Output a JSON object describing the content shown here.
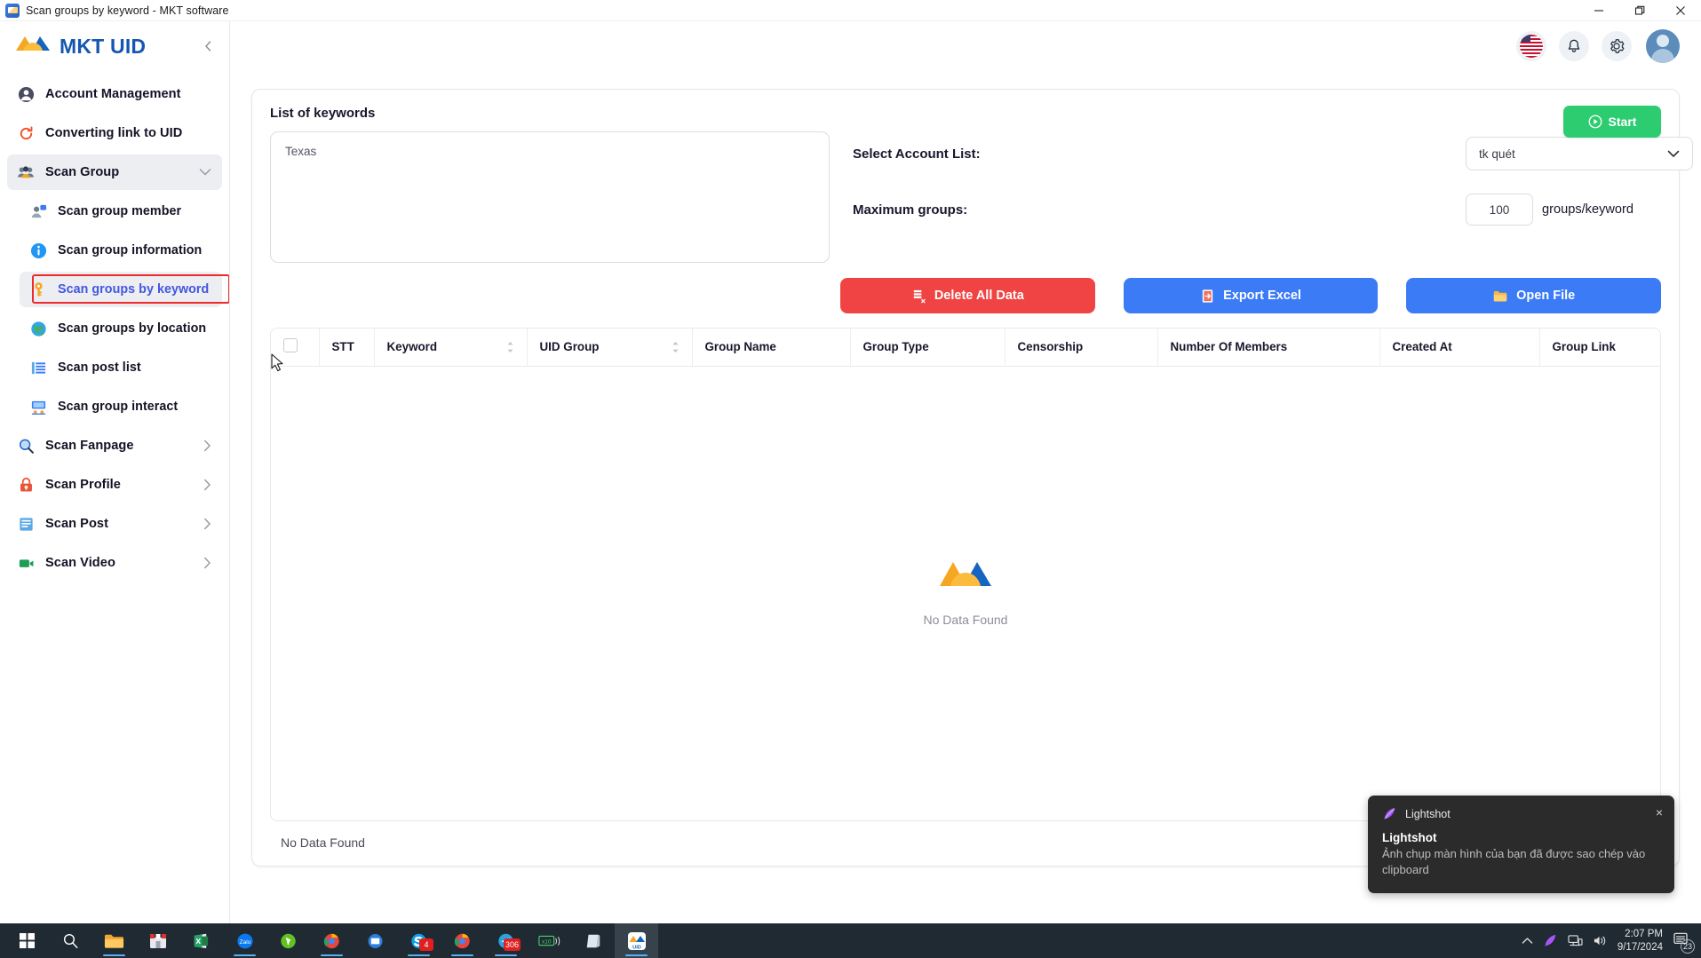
{
  "window": {
    "title": "Scan groups by keyword - MKT software",
    "minimize_label": "Minimize",
    "restore_label": "Restore",
    "close_label": "Close"
  },
  "sidebar": {
    "brand": "MKT UID",
    "collapse_label": "‹",
    "items": [
      {
        "label": "Account Management",
        "icon": "user-circle-icon",
        "level": 0,
        "state": "normal",
        "chevron": ""
      },
      {
        "label": "Converting link to UID",
        "icon": "refresh-icon",
        "level": 0,
        "state": "normal",
        "chevron": ""
      },
      {
        "label": "Scan Group",
        "icon": "group-icon",
        "level": 0,
        "state": "expanded",
        "chevron": "down"
      },
      {
        "label": "Scan group member",
        "icon": "member-icon",
        "level": 1,
        "state": "normal",
        "chevron": ""
      },
      {
        "label": "Scan group information",
        "icon": "info-icon",
        "level": 1,
        "state": "normal",
        "chevron": ""
      },
      {
        "label": "Scan groups by keyword",
        "icon": "key-icon",
        "level": 1,
        "state": "selected",
        "chevron": ""
      },
      {
        "label": "Scan groups by location",
        "icon": "globe-icon",
        "level": 1,
        "state": "normal",
        "chevron": ""
      },
      {
        "label": "Scan post list",
        "icon": "list-icon",
        "level": 1,
        "state": "normal",
        "chevron": ""
      },
      {
        "label": "Scan group interact",
        "icon": "interact-icon",
        "level": 1,
        "state": "normal",
        "chevron": ""
      },
      {
        "label": "Scan Fanpage",
        "icon": "magnifier-icon",
        "level": 0,
        "state": "normal",
        "chevron": "right"
      },
      {
        "label": "Scan Profile",
        "icon": "profile-lock-icon",
        "level": 0,
        "state": "normal",
        "chevron": "right"
      },
      {
        "label": "Scan Post",
        "icon": "post-icon",
        "level": 0,
        "state": "normal",
        "chevron": "right"
      },
      {
        "label": "Scan Video",
        "icon": "video-icon",
        "level": 0,
        "state": "normal",
        "chevron": "right"
      }
    ]
  },
  "header": {
    "language_icon": "us-flag-icon",
    "notifications_icon": "bell-icon",
    "settings_icon": "gear-icon",
    "avatar_icon": "user-avatar-icon"
  },
  "main": {
    "keywords_title": "List of keywords",
    "keywords_value": "Texas",
    "keywords_placeholder": "",
    "account_list_label": "Select Account List:",
    "account_list_value": "tk quét",
    "max_groups_label": "Maximum groups:",
    "max_groups_value": "100",
    "max_groups_unit": "groups/keyword",
    "start_button": "Start",
    "buttons": [
      {
        "label": "Delete All Data",
        "style": "danger",
        "icon": "delete-data-icon"
      },
      {
        "label": "Export Excel",
        "style": "primary",
        "icon": "excel-icon"
      },
      {
        "label": "Open File",
        "style": "primary",
        "icon": "folder-icon"
      }
    ]
  },
  "table": {
    "columns": [
      {
        "label": "",
        "sortable": false,
        "type": "checkbox"
      },
      {
        "label": "STT",
        "sortable": false
      },
      {
        "label": "Keyword",
        "sortable": true
      },
      {
        "label": "UID Group",
        "sortable": true
      },
      {
        "label": "Group Name",
        "sortable": false
      },
      {
        "label": "Group Type",
        "sortable": false
      },
      {
        "label": "Censorship",
        "sortable": false
      },
      {
        "label": "Number Of Members",
        "sortable": false
      },
      {
        "label": "Created At",
        "sortable": false
      },
      {
        "label": "Group Link",
        "sortable": false
      }
    ],
    "rows": [],
    "empty_message": "No Data Found",
    "footer_message": "No Data Found",
    "page_size": "10"
  },
  "toast": {
    "app_name": "Lightshot",
    "title": "Lightshot",
    "message": "Ảnh chụp màn hình của bạn đã được sao chép vào clipboard",
    "close_label": "×"
  },
  "taskbar": {
    "items": [
      {
        "name": "start-button",
        "icon": "windows-icon"
      },
      {
        "name": "search-button",
        "icon": "search-icon"
      },
      {
        "name": "file-explorer",
        "icon": "folder-icon"
      },
      {
        "name": "app-shop",
        "icon": "shop-icon"
      },
      {
        "name": "app-excel",
        "icon": "excel-icon"
      },
      {
        "name": "app-zalo",
        "icon": "zalo-icon",
        "label": "Zalo"
      },
      {
        "name": "app-media",
        "icon": "media-icon"
      },
      {
        "name": "app-chrome-profile",
        "icon": "chrome-icon"
      },
      {
        "name": "app-monitor",
        "icon": "monitor-icon"
      },
      {
        "name": "app-skype",
        "icon": "skype-icon",
        "badge": "4"
      },
      {
        "name": "app-chrome-2",
        "icon": "chrome-icon"
      },
      {
        "name": "app-telegram",
        "icon": "telegram-icon",
        "badge": "306"
      },
      {
        "name": "app-x10",
        "icon": "x10-icon",
        "label": "x10"
      },
      {
        "name": "app-notes",
        "icon": "notes-icon"
      },
      {
        "name": "app-mkt-uid",
        "icon": "mkt-uid-icon",
        "label": "UID"
      }
    ],
    "tray": {
      "overflow_icon": "chevron-up-icon",
      "lightshot_icon": "lightshot-feather-icon",
      "network_icon": "network-icon",
      "volume_icon": "volume-icon",
      "time": "2:07 PM",
      "date": "9/17/2024",
      "notification_count": "23"
    }
  },
  "colors": {
    "brand_blue": "#1557b0",
    "accent_blue": "#3b7bf6",
    "danger_red": "#f04444",
    "success_green": "#2ecc71",
    "selected_purple": "#4356e0",
    "highlight_border": "#ef2a2a"
  }
}
